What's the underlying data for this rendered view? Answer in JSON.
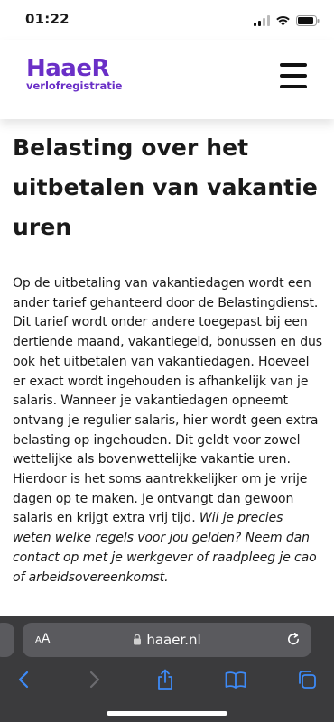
{
  "status_bar": {
    "time": "01:22"
  },
  "header": {
    "logo_main": "HaaeR",
    "logo_sub": "verlofregistratie",
    "brand_color": "#6a2fc7"
  },
  "article": {
    "title": "Belasting over het uitbetalen van vakantie uren",
    "body": "Op de uitbetaling van vakantiedagen wordt een ander tarief gehanteerd door de Belastingdienst. Dit tarief wordt onder andere toegepast bij een dertiende maand, vakantiegeld, bonussen en dus ook het uitbetalen van vakantiedagen. Hoeveel er exact wordt ingehouden is afhankelijk van je salaris. Wanneer je vakantiedagen opneemt ontvang je regulier salaris, hier wordt geen extra belasting op ingehouden. Dit geldt voor zowel wettelijke als bovenwettelijke vakantie uren. Hierdoor is het soms aantrekkelijker om je vrije dagen op te maken. Je ontvangt dan gewoon salaris en krijgt extra vrij tijd.",
    "body_italic": "Wil je precies weten welke regels voor jou gelden? Neem dan contact op met je werkgever of raadpleeg je cao of arbeidsovereenkomst."
  },
  "browser": {
    "aa_small": "A",
    "aa_large": "A",
    "url": "haaer.nl",
    "accent_color": "#3d8af7",
    "toolbar_icons": [
      "back-icon",
      "forward-icon",
      "share-icon",
      "bookmarks-icon",
      "tabs-icon"
    ]
  }
}
